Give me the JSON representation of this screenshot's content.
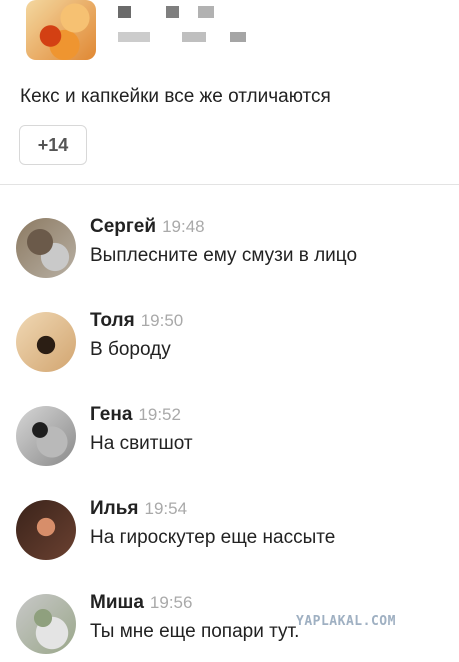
{
  "post": {
    "text": "Кекс и капкейки все же отличаются",
    "more_count": "+14"
  },
  "comments": [
    {
      "name": "Сергей",
      "time": "19:48",
      "text": "Выплесните ему смузи в лицо"
    },
    {
      "name": "Толя",
      "time": "19:50",
      "text": "В бороду"
    },
    {
      "name": "Гена",
      "time": "19:52",
      "text": "На свитшот"
    },
    {
      "name": "Илья",
      "time": "19:54",
      "text": "На гироскутер еще нассыте"
    },
    {
      "name": "Миша",
      "time": "19:56",
      "text": "Ты мне еще попари тут."
    }
  ],
  "watermark": "YAPLAKAL.COM"
}
